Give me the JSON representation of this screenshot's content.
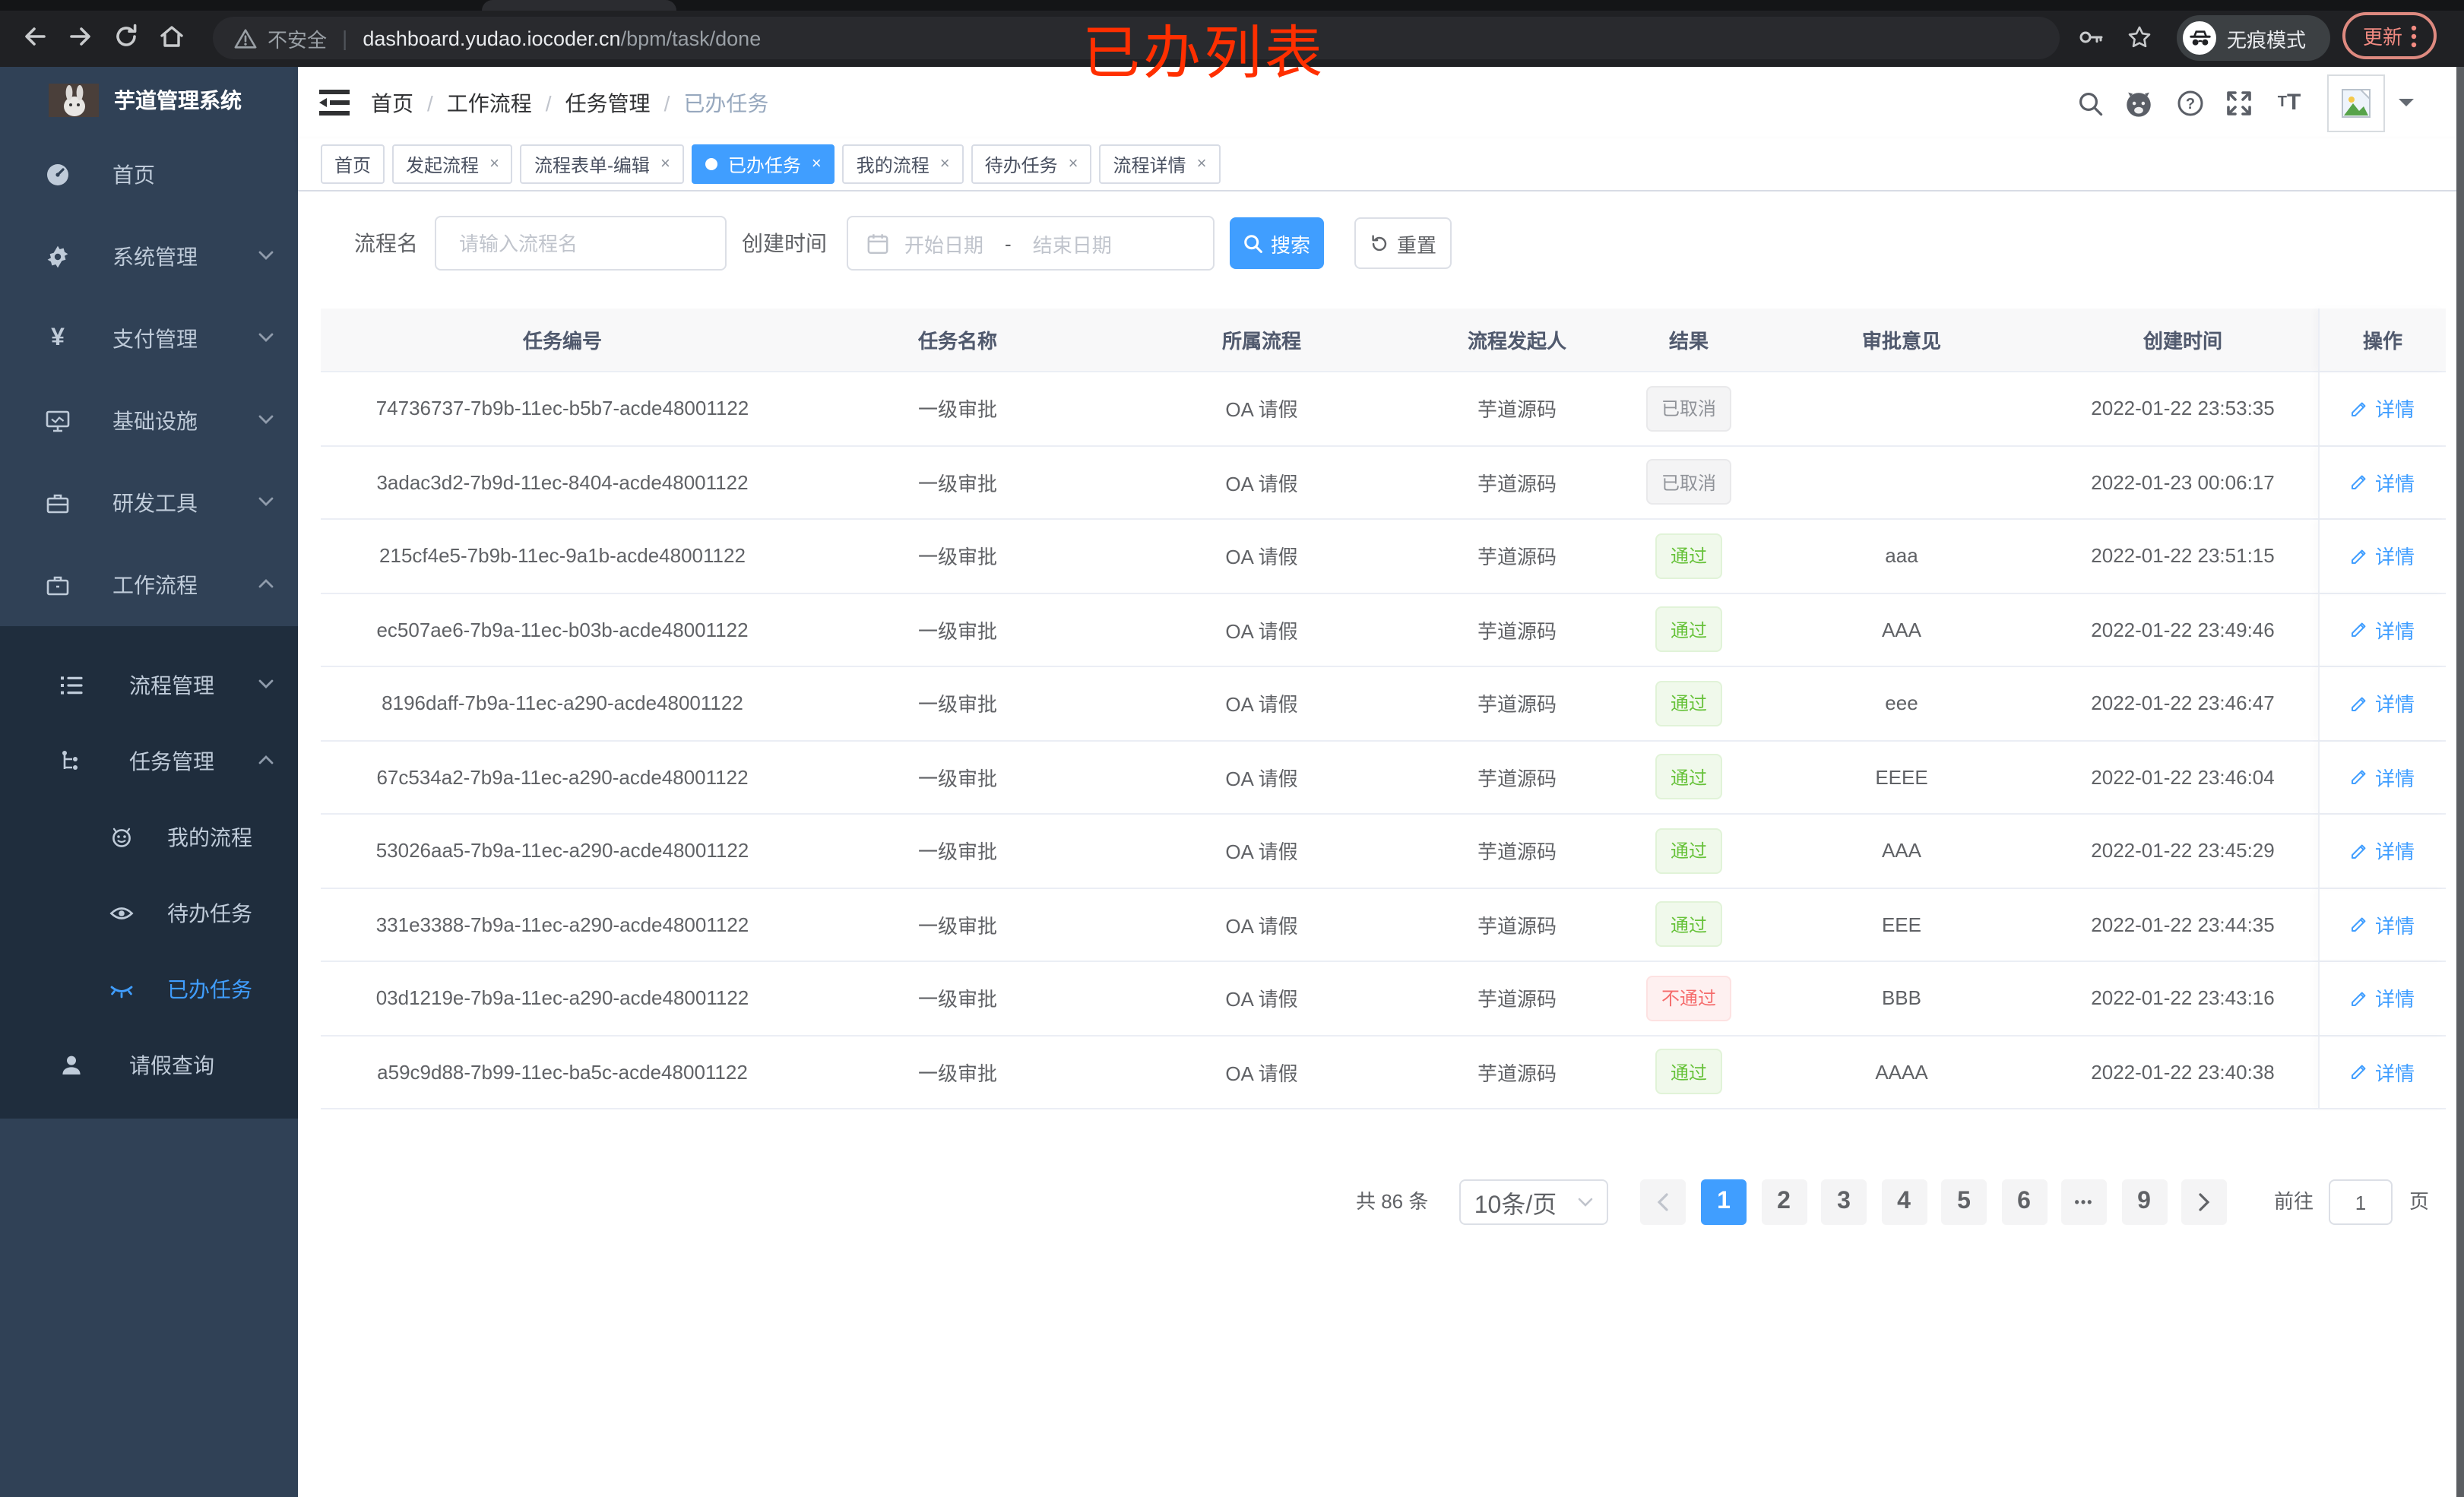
{
  "annotation": {
    "text": "已办列表",
    "color": "#ff2f00"
  },
  "browser": {
    "security_label": "不安全",
    "url_domain": "dashboard.yudao.iocoder.cn",
    "url_path": "/bpm/task/done",
    "incognito_label": "无痕模式",
    "update_label": "更新",
    "icons": [
      "back-icon",
      "forward-icon",
      "reload-icon",
      "home-icon",
      "warning-icon",
      "key-icon",
      "star-icon",
      "incognito-icon",
      "more-menu-icon"
    ]
  },
  "sidebar": {
    "app_title": "芋道管理系统",
    "items": [
      {
        "label": "首页",
        "icon": "dashboard-icon"
      },
      {
        "label": "系统管理",
        "icon": "gear-icon"
      },
      {
        "label": "支付管理",
        "icon": "yen-icon"
      },
      {
        "label": "基础设施",
        "icon": "monitor-icon"
      },
      {
        "label": "研发工具",
        "icon": "toolbox-icon"
      },
      {
        "label": "工作流程",
        "icon": "briefcase-icon"
      }
    ],
    "submenu": [
      {
        "label": "流程管理",
        "icon": "list-icon"
      },
      {
        "label": "任务管理",
        "icon": "tree-icon"
      },
      {
        "label": "我的流程",
        "icon": "robot-icon"
      },
      {
        "label": "待办任务",
        "icon": "eye-open-icon"
      },
      {
        "label": "已办任务",
        "icon": "eye-closed-icon"
      },
      {
        "label": "请假查询",
        "icon": "user-icon"
      }
    ]
  },
  "header": {
    "breadcrumb": [
      "首页",
      "工作流程",
      "任务管理",
      "已办任务"
    ],
    "icons": [
      "search-icon",
      "github-icon",
      "help-icon",
      "fullscreen-icon",
      "font-size-icon",
      "avatar",
      "caret-down-icon"
    ]
  },
  "tabs": [
    {
      "label": "首页"
    },
    {
      "label": "发起流程"
    },
    {
      "label": "流程表单-编辑"
    },
    {
      "label": "已办任务"
    },
    {
      "label": "我的流程"
    },
    {
      "label": "待办任务"
    },
    {
      "label": "流程详情"
    }
  ],
  "close_glyph": "×",
  "filters": {
    "name_label": "流程名",
    "name_placeholder": "请输入流程名",
    "time_label": "创建时间",
    "start_placeholder": "开始日期",
    "range_separator": "-",
    "end_placeholder": "结束日期",
    "search_label": "搜索",
    "reset_label": "重置"
  },
  "table": {
    "columns": [
      "任务编号",
      "任务名称",
      "所属流程",
      "流程发起人",
      "结果",
      "审批意见",
      "创建时间",
      "操作"
    ],
    "action_label": "详情",
    "rows": [
      {
        "id": "74736737-7b9b-11ec-b5b7-acde48001122",
        "name": "一级审批",
        "process": "OA 请假",
        "starter": "芋道源码",
        "result": "已取消",
        "result_type": "info",
        "comment": "",
        "time": "2022-01-22 23:53:35"
      },
      {
        "id": "3adac3d2-7b9d-11ec-8404-acde48001122",
        "name": "一级审批",
        "process": "OA 请假",
        "starter": "芋道源码",
        "result": "已取消",
        "result_type": "info",
        "comment": "",
        "time": "2022-01-23 00:06:17"
      },
      {
        "id": "215cf4e5-7b9b-11ec-9a1b-acde48001122",
        "name": "一级审批",
        "process": "OA 请假",
        "starter": "芋道源码",
        "result": "通过",
        "result_type": "success",
        "comment": "aaa",
        "time": "2022-01-22 23:51:15"
      },
      {
        "id": "ec507ae6-7b9a-11ec-b03b-acde48001122",
        "name": "一级审批",
        "process": "OA 请假",
        "starter": "芋道源码",
        "result": "通过",
        "result_type": "success",
        "comment": "AAA",
        "time": "2022-01-22 23:49:46"
      },
      {
        "id": "8196daff-7b9a-11ec-a290-acde48001122",
        "name": "一级审批",
        "process": "OA 请假",
        "starter": "芋道源码",
        "result": "通过",
        "result_type": "success",
        "comment": "eee",
        "time": "2022-01-22 23:46:47"
      },
      {
        "id": "67c534a2-7b9a-11ec-a290-acde48001122",
        "name": "一级审批",
        "process": "OA 请假",
        "starter": "芋道源码",
        "result": "通过",
        "result_type": "success",
        "comment": "EEEE",
        "time": "2022-01-22 23:46:04"
      },
      {
        "id": "53026aa5-7b9a-11ec-a290-acde48001122",
        "name": "一级审批",
        "process": "OA 请假",
        "starter": "芋道源码",
        "result": "通过",
        "result_type": "success",
        "comment": "AAA",
        "time": "2022-01-22 23:45:29"
      },
      {
        "id": "331e3388-7b9a-11ec-a290-acde48001122",
        "name": "一级审批",
        "process": "OA 请假",
        "starter": "芋道源码",
        "result": "通过",
        "result_type": "success",
        "comment": "EEE",
        "time": "2022-01-22 23:44:35"
      },
      {
        "id": "03d1219e-7b9a-11ec-a290-acde48001122",
        "name": "一级审批",
        "process": "OA 请假",
        "starter": "芋道源码",
        "result": "不通过",
        "result_type": "danger",
        "comment": "BBB",
        "time": "2022-01-22 23:43:16"
      },
      {
        "id": "a59c9d88-7b99-11ec-ba5c-acde48001122",
        "name": "一级审批",
        "process": "OA 请假",
        "starter": "芋道源码",
        "result": "通过",
        "result_type": "success",
        "comment": "AAAA",
        "time": "2022-01-22 23:40:38"
      }
    ]
  },
  "pagination": {
    "total_label": "共 86 条",
    "page_size": "10条/页",
    "pages": [
      "1",
      "2",
      "3",
      "4",
      "5",
      "6"
    ],
    "ellipsis": "•••",
    "last_page": "9",
    "active_page": "1",
    "jump_label": "前往",
    "jump_value": "1",
    "jump_unit": "页"
  },
  "colors": {
    "accent": "#409eff",
    "success": "#67c23a",
    "danger": "#f56c6c",
    "info": "#909399",
    "sidebar": "#304156",
    "submenu": "#1f2d3d"
  }
}
